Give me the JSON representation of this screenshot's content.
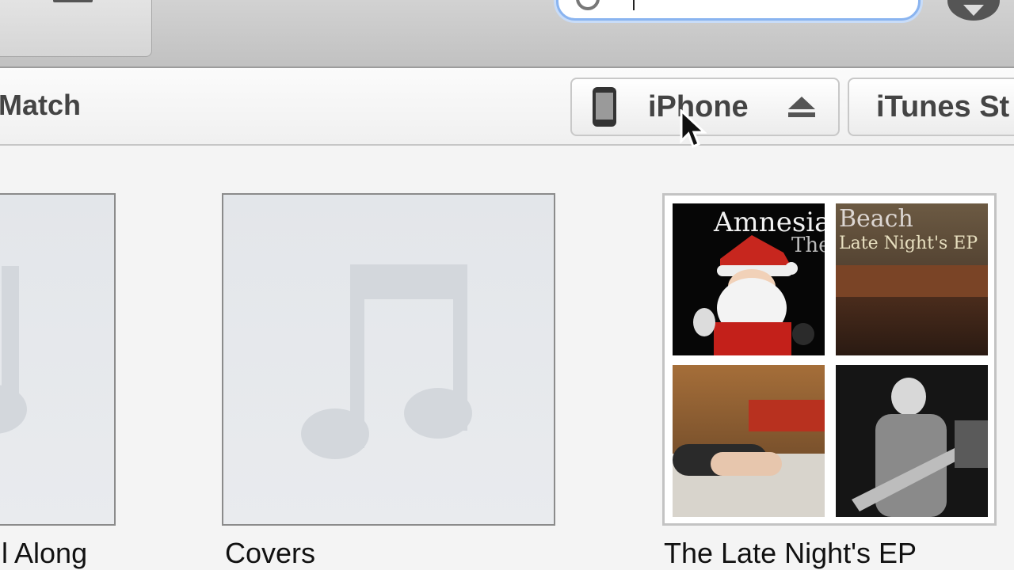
{
  "header": {
    "match_label": "Match",
    "device_button_label": "iPhone",
    "store_button_label": "iTunes St"
  },
  "albums": [
    {
      "title": "ll Along"
    },
    {
      "title": "Covers"
    },
    {
      "title": "The Late Night's EP",
      "tiles": [
        {
          "text_line1": "Amnesia",
          "text_line2": "The"
        },
        {
          "text_line1": "Beach",
          "text_line2": "Late Night's EP"
        },
        {},
        {}
      ]
    }
  ],
  "colors": {
    "search_focus": "#8ab4f0",
    "toolbar": "#c8c8c8",
    "text": "#444444"
  },
  "icons": [
    "list-icon",
    "search-icon",
    "download-icon",
    "iphone-icon",
    "eject-icon",
    "music-note-icon",
    "mouse-cursor-icon"
  ]
}
